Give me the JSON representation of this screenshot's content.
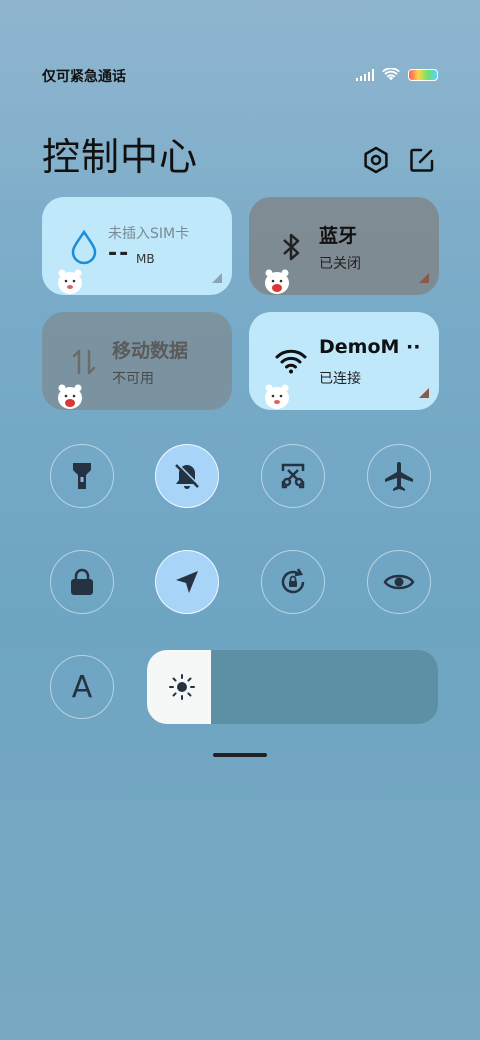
{
  "status": {
    "text": "仅可紧急通话"
  },
  "header": {
    "title": "控制中心"
  },
  "tiles": {
    "data": {
      "title": "未插入SIM卡",
      "value": "--",
      "unit": "MB"
    },
    "bluetooth": {
      "title": "蓝牙",
      "status": "已关闭"
    },
    "mobile": {
      "title": "移动数据",
      "status": "不可用"
    },
    "wifi": {
      "title": "DemoM ··",
      "status": "已连接"
    }
  },
  "toggles_row1": [
    {
      "name": "flashlight",
      "active": false
    },
    {
      "name": "mute",
      "active": true
    },
    {
      "name": "screenshot",
      "active": false
    },
    {
      "name": "airplane",
      "active": false
    }
  ],
  "toggles_row2": [
    {
      "name": "lock-screen",
      "active": false
    },
    {
      "name": "location",
      "active": true
    },
    {
      "name": "auto-rotate",
      "active": false
    },
    {
      "name": "reading-mode",
      "active": false
    }
  ],
  "auto_brightness": {
    "label": "A"
  },
  "brightness_level_fraction": 0.22,
  "colors": {
    "accent": "#a8d4f7",
    "tile_light": "#bfe8fb"
  }
}
